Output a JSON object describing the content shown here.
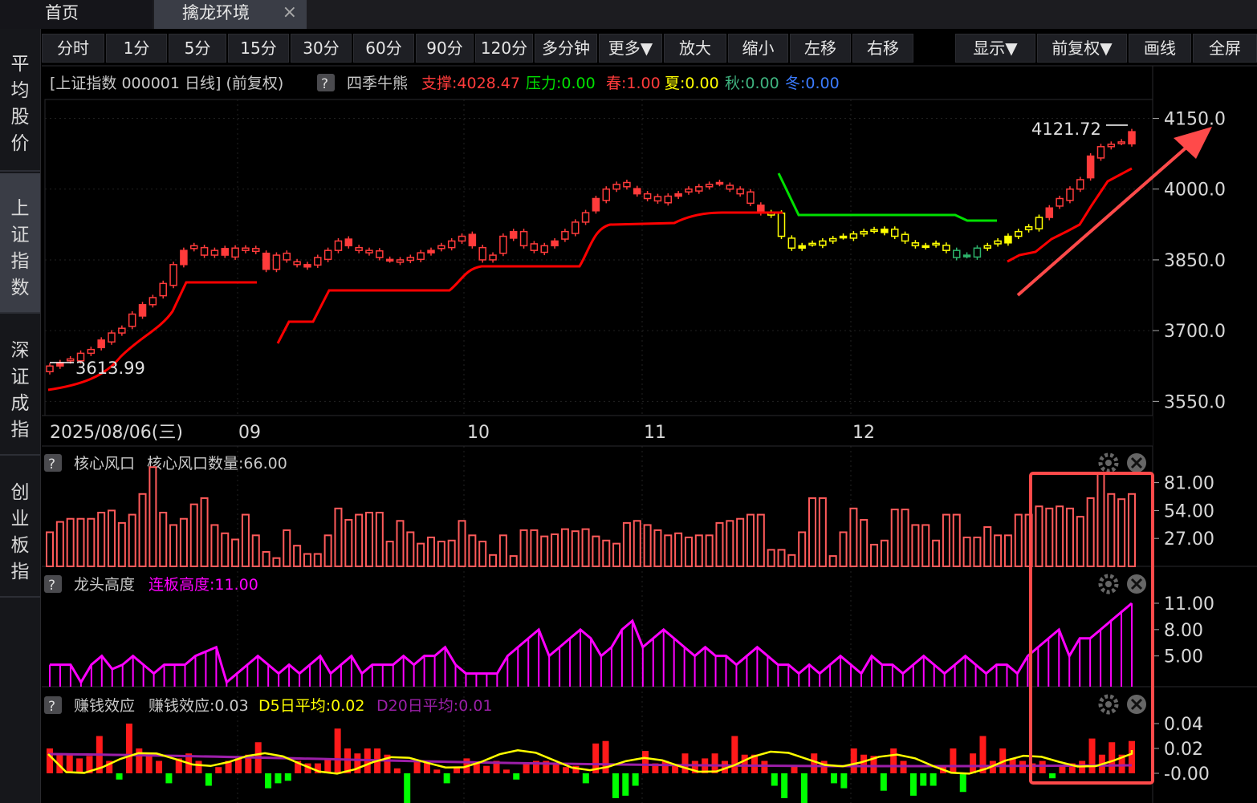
{
  "tabs": {
    "home": "首页",
    "active": "擒龙环境",
    "close": "×"
  },
  "sidebar": [
    {
      "label": "平均股价"
    },
    {
      "label": "上证指数",
      "active": true
    },
    {
      "label": "深证成指"
    },
    {
      "label": "创业板指"
    }
  ],
  "toolbar": [
    "分时",
    "1分",
    "5分",
    "15分",
    "30分",
    "60分",
    "90分",
    "120分",
    "多分钟",
    "更多▼",
    "放大",
    "缩小",
    "左移",
    "右移",
    "显示▼",
    "前复权▼",
    "画线",
    "全屏"
  ],
  "main_chart": {
    "title": "[上证指数 000001 日线] (前复权)",
    "help": "?",
    "indicator_name": "四季牛熊",
    "support_label": "支撑:",
    "support_value": "4028.47",
    "pressure_label": "压力:",
    "pressure_value": "0.00",
    "spring_label": "春:",
    "spring_value": "1.00",
    "summer_label": "夏:",
    "summer_value": "0.00",
    "autumn_label": "秋:",
    "autumn_value": "0.00",
    "winter_label": "冬:",
    "winter_value": "0.00",
    "high_label": "4121.72",
    "low_label": "3613.99",
    "y_ticks": [
      "4150.0",
      "4000.0",
      "3850.0",
      "3700.0",
      "3550.0"
    ],
    "x_labels": [
      "2025/08/06(三)",
      "09",
      "10",
      "11",
      "12"
    ]
  },
  "panel1": {
    "help": "?",
    "title": "核心风口",
    "value_label": "核心风口数量:66.00",
    "y_ticks": [
      "81.00",
      "54.00",
      "27.00"
    ]
  },
  "panel2": {
    "help": "?",
    "title": "龙头高度",
    "value_label": "连板高度:11.00",
    "y_ticks": [
      "11.00",
      "8.00",
      "5.00"
    ]
  },
  "panel3": {
    "help": "?",
    "title": "赚钱效应",
    "value_label": "赚钱效应:0.03",
    "d5_label": "D5日平均:0.02",
    "d20_label": "D20日平均:0.01",
    "y_ticks": [
      "0.04",
      "0.02",
      "-0.00"
    ]
  },
  "colors": {
    "up": "#ff3b3b",
    "down_green": "#00e000",
    "yellow": "#ffff00",
    "magenta": "#ff00ff",
    "purple": "#9b1fa8",
    "annot": "#ff4a4a"
  },
  "chart_data": {
    "type": "candlestick",
    "title": "[上证指数 000001 日线] (前复权)",
    "ylim": [
      3520,
      4190
    ],
    "candles_close": [
      3625,
      3632,
      3640,
      3652,
      3660,
      3680,
      3695,
      3705,
      3735,
      3755,
      3770,
      3800,
      3840,
      3870,
      3880,
      3860,
      3870,
      3860,
      3875,
      3870,
      3868,
      3830,
      3860,
      3850,
      3840,
      3835,
      3855,
      3870,
      3890,
      3880,
      3870,
      3865,
      3855,
      3850,
      3845,
      3855,
      3865,
      3870,
      3880,
      3890,
      3900,
      3880,
      3850,
      3860,
      3900,
      3910,
      3880,
      3870,
      3880,
      3890,
      3910,
      3930,
      3950,
      3980,
      4000,
      4010,
      4005,
      3990,
      3980,
      3975,
      3985,
      3990,
      4000,
      4005,
      4010,
      4012,
      4000,
      3990,
      3970,
      3950,
      3945,
      3900,
      3875,
      3880,
      3885,
      3890,
      3895,
      3900,
      3905,
      3910,
      3912,
      3915,
      3900,
      3890,
      3880,
      3878,
      3885,
      3870,
      3855,
      3860,
      3875,
      3880,
      3890,
      3900,
      3910,
      3920,
      3940,
      3960,
      3980,
      4000,
      4020,
      4070,
      4090,
      4095,
      4100,
      4121.72
    ],
    "support_line": "stepped red line rising from 3550 to 4028",
    "high": 4121.72,
    "low": 3613.99
  }
}
